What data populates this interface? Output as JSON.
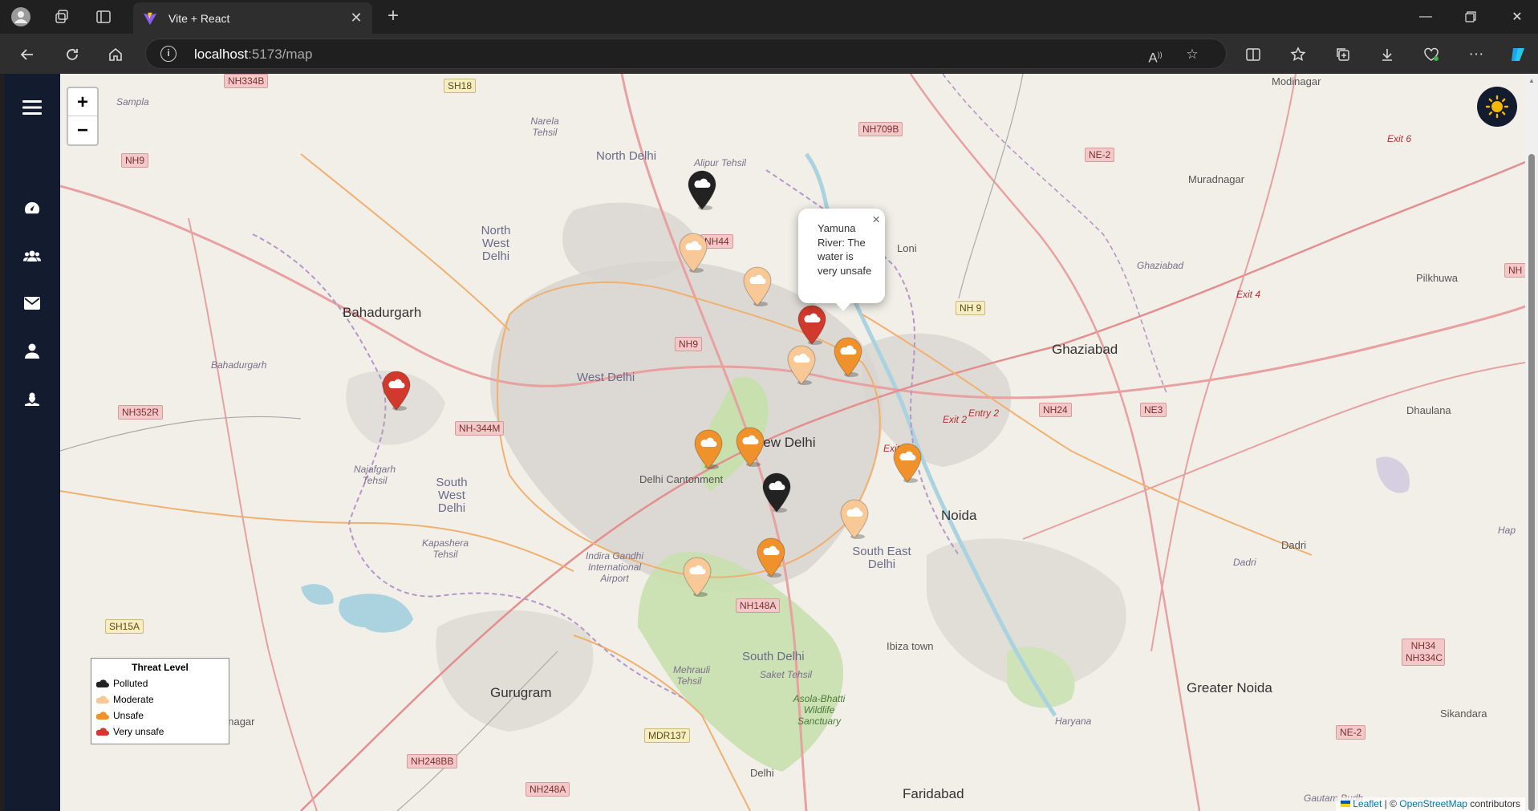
{
  "browser": {
    "tab": {
      "title": "Vite + React"
    },
    "address": {
      "host": "localhost",
      "path": ":5173/map"
    }
  },
  "sidebar": {
    "items": [
      {
        "icon": "menu-icon"
      },
      {
        "icon": "dashboard-icon"
      },
      {
        "icon": "users-icon"
      },
      {
        "icon": "mail-icon"
      },
      {
        "icon": "user-icon"
      },
      {
        "icon": "user-heart-icon"
      }
    ]
  },
  "map": {
    "zoom_in": "+",
    "zoom_out": "−",
    "popup": {
      "text": "Yamuna River: The water is very unsafe",
      "close": "×"
    },
    "legend": {
      "title": "Threat Level",
      "items": [
        {
          "label": "Polluted",
          "color": "#222222"
        },
        {
          "label": "Moderate",
          "color": "#f8c996"
        },
        {
          "label": "Unsafe",
          "color": "#f0922b"
        },
        {
          "label": "Very unsafe",
          "color": "#d0392b"
        }
      ]
    },
    "markers": [
      {
        "level": "Polluted"
      },
      {
        "level": "Moderate"
      },
      {
        "level": "Moderate"
      },
      {
        "level": "Very unsafe"
      },
      {
        "level": "Moderate"
      },
      {
        "level": "Unsafe"
      },
      {
        "level": "Very unsafe"
      },
      {
        "level": "Unsafe"
      },
      {
        "level": "Unsafe"
      },
      {
        "level": "Unsafe"
      },
      {
        "level": "Polluted"
      },
      {
        "level": "Moderate"
      },
      {
        "level": "Unsafe"
      },
      {
        "level": "Moderate"
      }
    ],
    "labels": {
      "new_delhi": "New Delhi",
      "north_delhi": "North Delhi",
      "north_west_delhi": "North West Delhi",
      "west_delhi": "West Delhi",
      "south_west_delhi": "South West Delhi",
      "south_delhi": "South Delhi",
      "south_east_delhi": "South East Delhi",
      "bahadurgarh": "Bahadurgarh",
      "ghaziabad": "Ghaziabad",
      "noida": "Noida",
      "gurugram": "Gurugram",
      "greater_noida": "Greater Noida",
      "faridabad": "Faridabad",
      "loni": "Loni",
      "muradnagar": "Muradnagar",
      "modinagar": "Modinagar",
      "pilkhuwa": "Pilkhuwa",
      "dhaulana": "Dhaulana",
      "dadri": "Dadri",
      "sikandara": "Sikandara",
      "tibiza_town": "Ibiza town",
      "delhi_cantonment": "Delhi Cantonment",
      "airport": "Indira Gandhi International Airport",
      "asola": "Asola-Bhatti Wildlife Sanctuary",
      "najafgarh": "Najafgarh Tehsil",
      "kapashera": "Kapashera Tehsil",
      "alipur": "Alipur Tehsil",
      "narela": "Narela Tehsil",
      "sampla": "Sampla",
      "mehrauli": "Mehrauli Tehsil",
      "saket": "Saket Tehsil",
      "haryana": "Haryana",
      "nagar": "nnagar",
      "entry2": "Entry 2",
      "exit1": "Exit 1",
      "exit2": "Exit 2",
      "exit4": "Exit 4",
      "exit6": "Exit 6",
      "bahadurgarh_ital": "Bahadurgarh",
      "ghaziabad_ital": "Ghaziabad",
      "dadri_ital": "Dadri",
      "hap": "Hap",
      "delhi_small": "Delhi",
      "gautam": "Gautam Budh"
    },
    "roads": {
      "nh334b": "NH334B",
      "sh18": "SH18",
      "nh709b": "NH709B",
      "ne2_top": "NE-2",
      "nh9_left": "NH9",
      "nh44": "NH44",
      "nh9_mid": "NH9",
      "nh9_right": "NH 9",
      "nh352r": "NH352R",
      "nh344m": "NH-344M",
      "nh24": "NH24",
      "ne3": "NE3",
      "sh15a": "SH15A",
      "nh148a": "NH148A",
      "mdr137": "MDR137",
      "nh248bb": "NH248BB",
      "nh248a": "NH248A",
      "nh34": "NH34 NH334C",
      "ne2_bottom": "NE-2",
      "nh_right": "NH"
    },
    "attribution": {
      "leaflet": "Leaflet",
      "sep": " | © ",
      "osm": "OpenStreetMap",
      "rest": " contributors"
    }
  }
}
